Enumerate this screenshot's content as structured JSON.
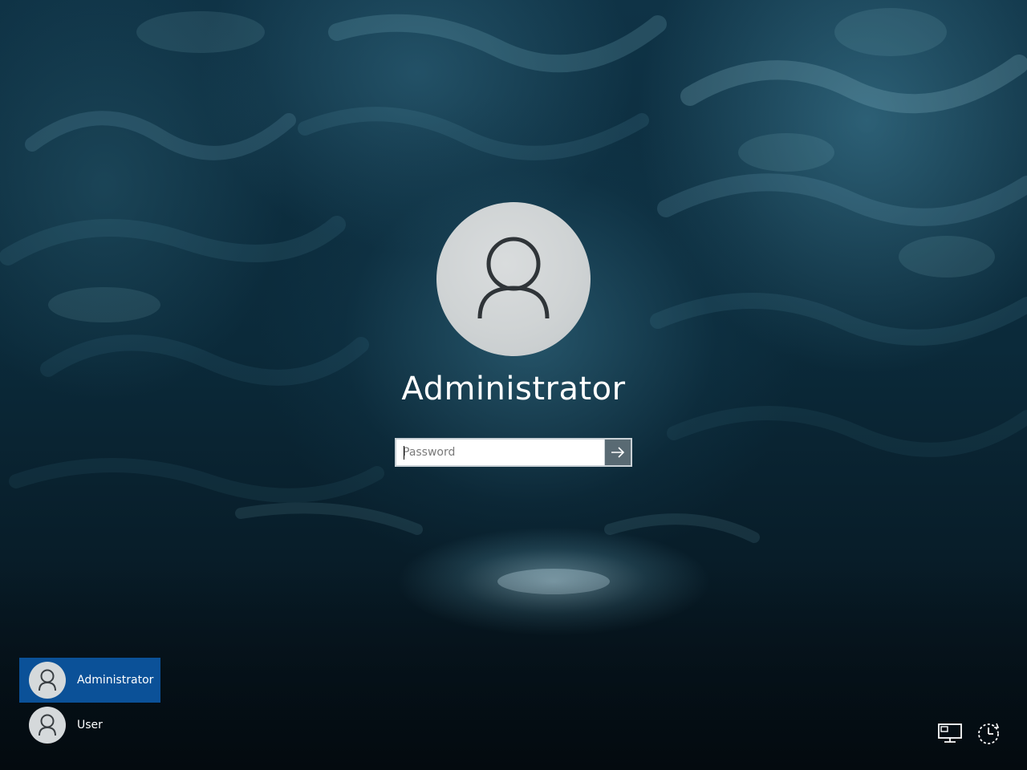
{
  "selected_user": {
    "name": "Administrator",
    "avatar_icon": "user-silhouette-icon"
  },
  "password": {
    "placeholder": "Password",
    "value": "",
    "submit_icon": "arrow-right-icon"
  },
  "user_list": [
    {
      "name": "Administrator",
      "selected": true
    },
    {
      "name": "User",
      "selected": false
    }
  ],
  "corner_icons": {
    "network": "network-icon",
    "power": "power-icon"
  },
  "colors": {
    "selected_tile": "#0b5198",
    "text": "#ffffff"
  }
}
